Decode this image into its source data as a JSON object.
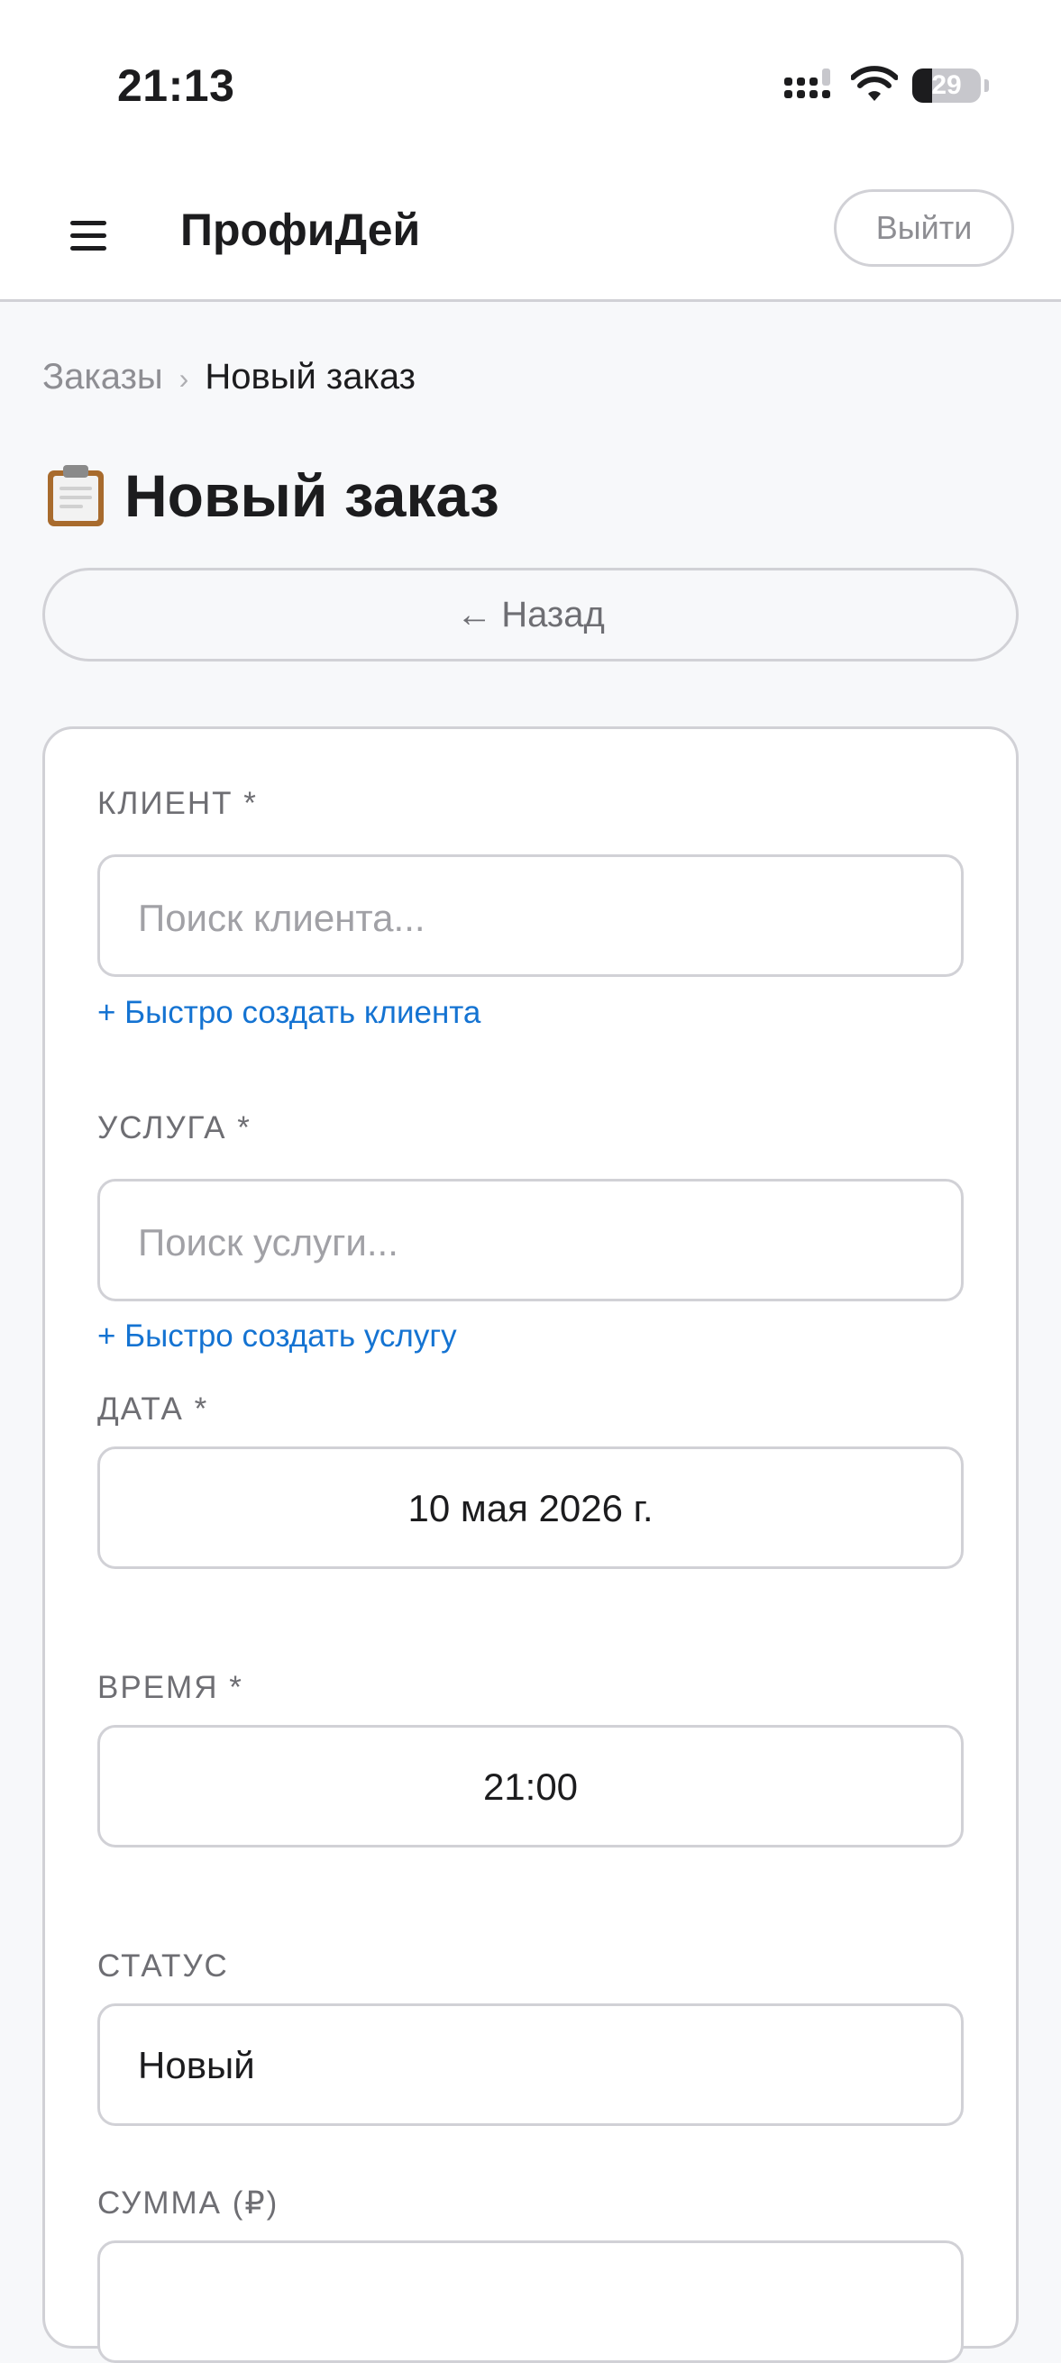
{
  "status_bar": {
    "time": "21:13",
    "battery": "29",
    "battery_level": 0.29,
    "icons": [
      "cellular-signal-icon",
      "wifi-icon",
      "battery-icon"
    ]
  },
  "header": {
    "menu_icon": "hamburger-menu-icon",
    "app_name": "ПрофиДей",
    "logout_label": "Выйти"
  },
  "breadcrumb": {
    "items": [
      "Заказы",
      "Новый заказ"
    ],
    "separator": "›"
  },
  "page": {
    "title_icon": "clipboard-icon",
    "title": "Новый заказ",
    "back_arrow": "←",
    "back_label": "Назад"
  },
  "form": {
    "client": {
      "label": "КЛИЕНТ *",
      "placeholder": "Поиск клиента...",
      "quick_create": "+ Быстро создать клиента"
    },
    "service": {
      "label": "УСЛУГА *",
      "placeholder": "Поиск услуги...",
      "quick_create": "+ Быстро создать услугу"
    },
    "date": {
      "label": "ДАТА *",
      "value": "10 мая 2026 г."
    },
    "time": {
      "label": "ВРЕМЯ *",
      "value": "21:00"
    },
    "status": {
      "label": "СТАТУС",
      "value": "Новый"
    },
    "amount": {
      "label": "СУММА (₽)",
      "value": ""
    }
  },
  "colors": {
    "accent_link": "#1473d2",
    "border": "#d1d1d6",
    "background": "#f7f8fa",
    "text": "#1c1c1e",
    "muted": "#8e8e93"
  }
}
